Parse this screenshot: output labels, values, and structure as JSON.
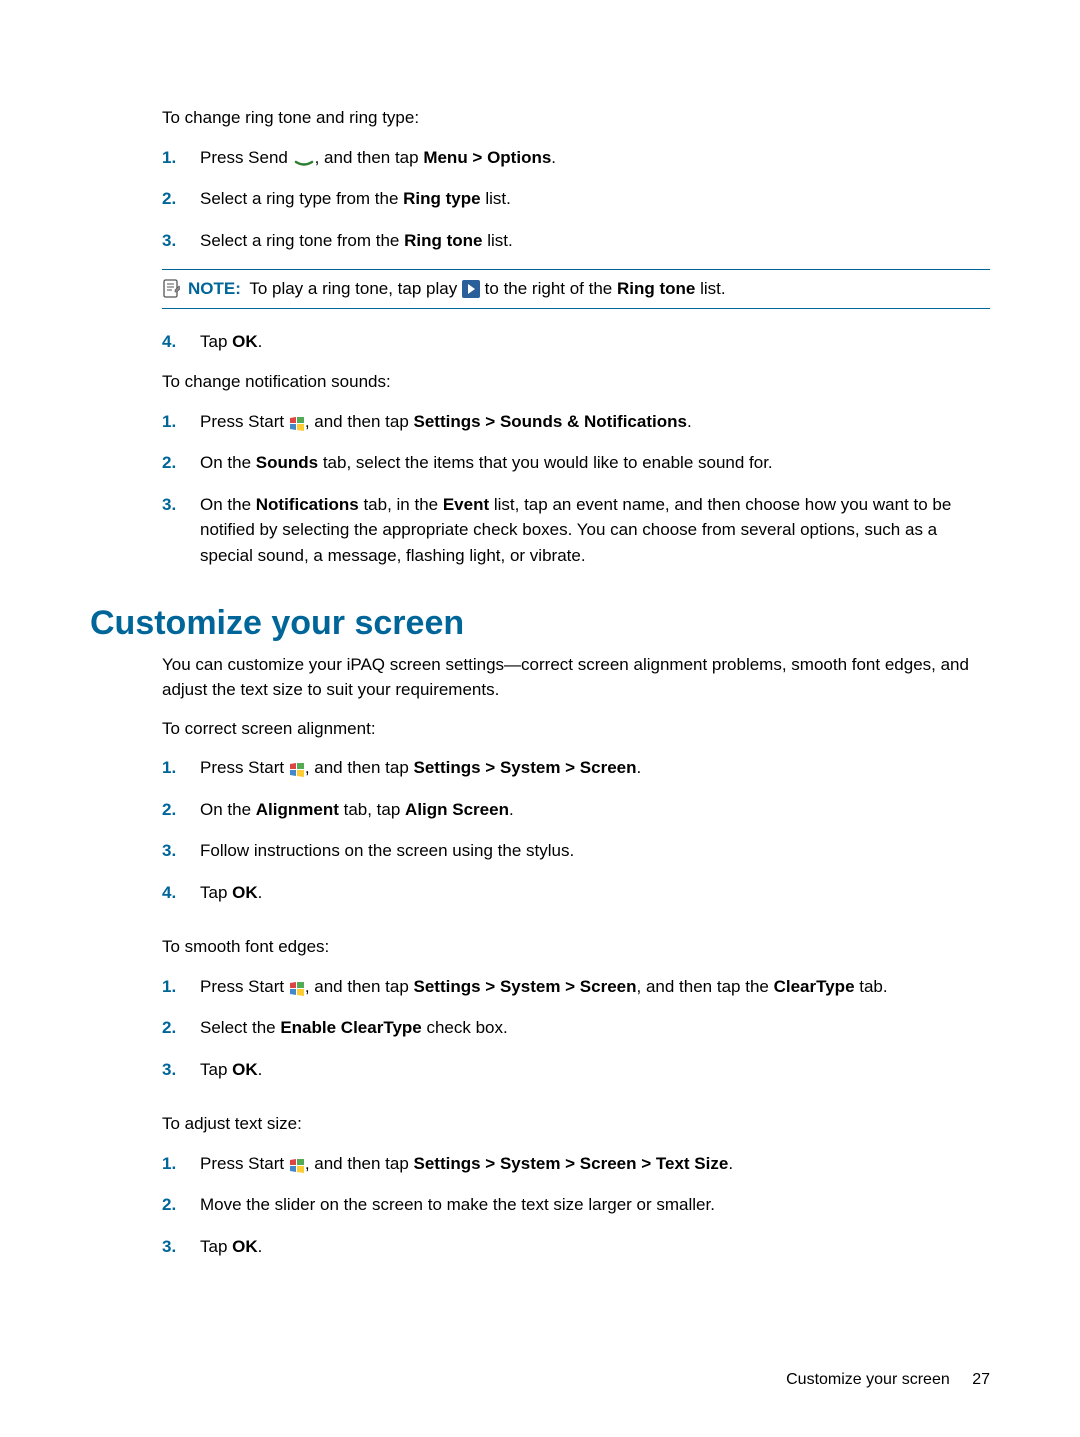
{
  "section1": {
    "intro1": "To change ring tone and ring type:",
    "s1": {
      "a": "Press Send ",
      "b": ", and then tap ",
      "c": "Menu > Options",
      "d": "."
    },
    "s2": {
      "a": "Select a ring type from the ",
      "b": "Ring type",
      "c": " list."
    },
    "s3": {
      "a": "Select a ring tone from the ",
      "b": "Ring tone",
      "c": " list."
    },
    "note": {
      "label": "NOTE:",
      "a": "To play a ring tone, tap play ",
      "b": " to the right of the ",
      "c": "Ring tone",
      "d": " list."
    },
    "s4": {
      "a": "Tap ",
      "b": "OK",
      "c": "."
    },
    "intro2": "To change notification sounds:",
    "n1": {
      "a": "Press Start ",
      "b": ", and then tap ",
      "c": "Settings > Sounds & Notifications",
      "d": "."
    },
    "n2": {
      "a": "On the ",
      "b": "Sounds",
      "c": " tab, select the items that you would like to enable sound for."
    },
    "n3": {
      "a": "On the ",
      "b": "Notifications",
      "c": " tab, in the ",
      "d": "Event",
      "e": " list, tap an event name, and then choose how you want to be notified by selecting the appropriate check boxes. You can choose from several options, such as a special sound, a message, flashing light, or vibrate."
    }
  },
  "heading": "Customize your screen",
  "section2": {
    "intro": "You can customize your iPAQ screen settings—correct screen alignment problems, smooth font edges, and adjust the text size to suit your requirements.",
    "alignIntro": "To correct screen alignment:",
    "a1": {
      "a": "Press Start ",
      "b": ", and then tap ",
      "c": "Settings > System > Screen",
      "d": "."
    },
    "a2": {
      "a": "On the ",
      "b": "Alignment",
      "c": " tab, tap ",
      "d": "Align Screen",
      "e": "."
    },
    "a3": {
      "a": "Follow instructions on the screen using the stylus."
    },
    "a4": {
      "a": "Tap ",
      "b": "OK",
      "c": "."
    },
    "smoothIntro": "To smooth font edges:",
    "sm1": {
      "a": "Press Start ",
      "b": ", and then tap ",
      "c": "Settings > System > Screen",
      "d": ", and then tap the ",
      "e": "ClearType",
      "f": " tab."
    },
    "sm2": {
      "a": "Select the ",
      "b": "Enable ClearType",
      "c": " check box."
    },
    "sm3": {
      "a": "Tap ",
      "b": "OK",
      "c": "."
    },
    "sizeIntro": "To adjust text size:",
    "sz1": {
      "a": "Press Start ",
      "b": ", and then tap ",
      "c": "Settings > System > Screen > Text Size",
      "d": "."
    },
    "sz2": {
      "a": "Move the slider on the screen to make the text size larger or smaller."
    },
    "sz3": {
      "a": "Tap ",
      "b": "OK",
      "c": "."
    }
  },
  "footer": {
    "text": "Customize your screen",
    "page": "27"
  },
  "labels": {
    "n1": "1.",
    "n2": "2.",
    "n3": "3.",
    "n4": "4."
  }
}
